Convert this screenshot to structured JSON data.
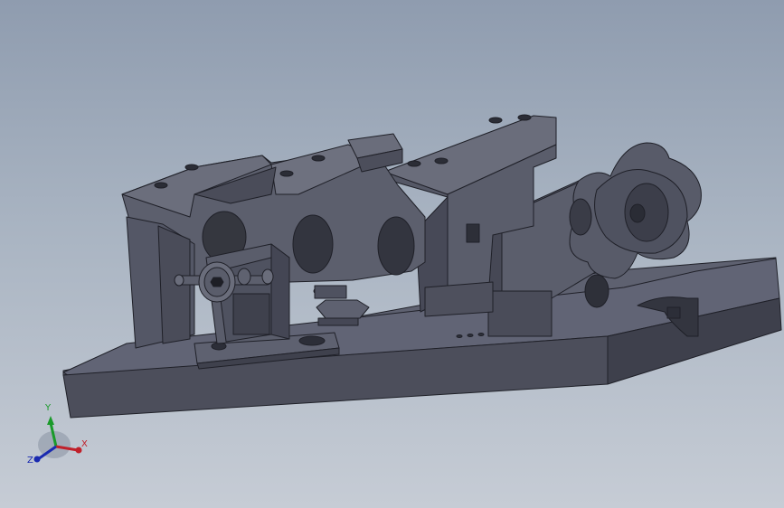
{
  "triad": {
    "x_label": "X",
    "y_label": "Y",
    "z_label": "Z",
    "x_color": "#c0202a",
    "y_color": "#1a9a2a",
    "z_color": "#1a2ab0"
  },
  "colors": {
    "background_top": "#8f9caf",
    "background_bottom": "#c6ccd5",
    "part_face": "#5a5d6b",
    "part_dark": "#2c2e38"
  }
}
